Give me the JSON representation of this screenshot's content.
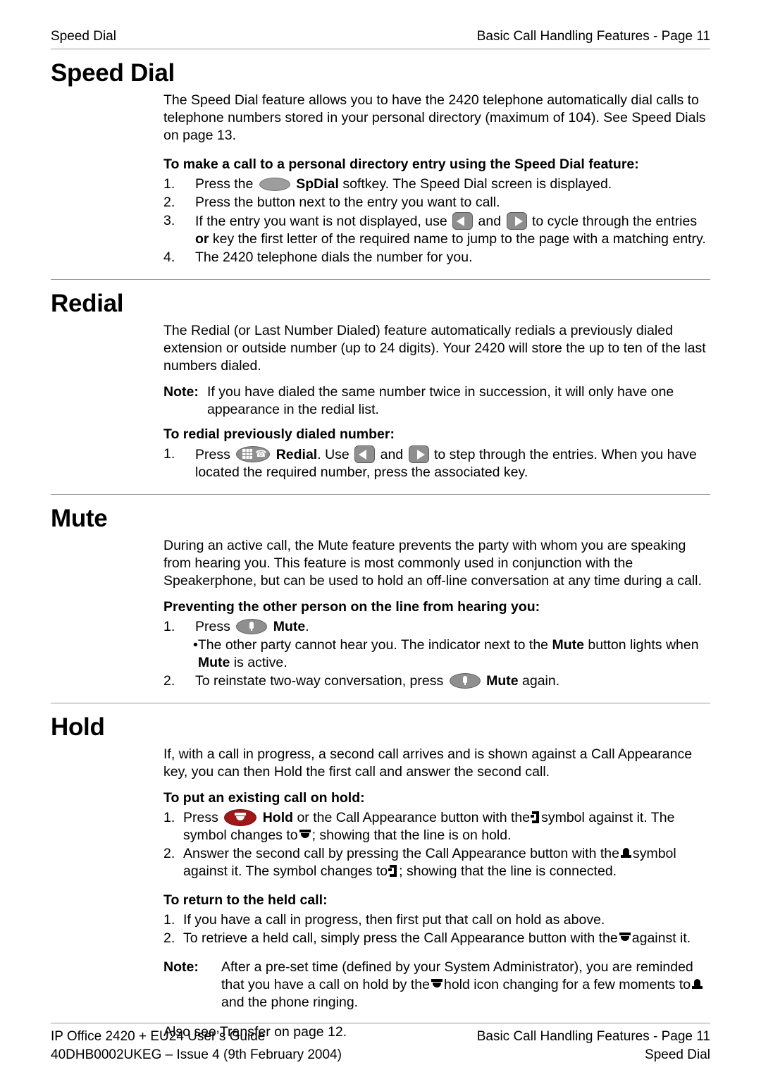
{
  "header": {
    "left": "Speed Dial",
    "right": "Basic Call Handling Features - Page 11"
  },
  "sections": {
    "speed_dial": {
      "title": "Speed Dial",
      "lead": "The Speed Dial feature allows you to have the 2420 telephone automatically dial calls to telephone numbers stored in your personal directory (maximum of 104). See Speed Dials on page 13.",
      "subhead": "To make a call to a personal directory entry using the Speed Dial feature:",
      "step1_num": "1.",
      "step1_a": "Press the",
      "step1_bold": "SpDial",
      "step1_b": "softkey. The Speed Dial screen is displayed.",
      "step2_num": "2.",
      "step2": "Press the button next to the entry you want to call.",
      "step3_num": "3.",
      "step3_a": "If the entry you want is not displayed, use",
      "step3_and": "and",
      "step3_b": "to cycle through the entries",
      "step3_or": "or",
      "step3_c": "key the first letter of the required name to jump to the page with a matching entry.",
      "step4_num": "4.",
      "step4": "The 2420 telephone dials the number for you."
    },
    "redial": {
      "title": "Redial",
      "lead": "The Redial (or Last Number Dialed) feature automatically redials a previously dialed extension or outside number (up to 24 digits). Your 2420 will store the up to ten of the last numbers dialed.",
      "note_label": "Note:",
      "note_text": "If you have dialed the same number twice in succession, it will only have one appearance in the redial list.",
      "subhead": "To redial previously dialed number:",
      "step1_num": "1.",
      "step1_a": "Press",
      "step1_bold": "Redial",
      "step1_b": ". Use",
      "step1_and": "and",
      "step1_c": "to step through the entries. When you have located the required number, press the associated key."
    },
    "mute": {
      "title": "Mute",
      "lead": "During an active call, the Mute feature prevents the party with whom you are speaking from hearing you. This feature is most commonly used in conjunction with the Speakerphone, but can be used to hold an off-line conversation at any time during a call.",
      "subhead": "Preventing the other person on the line from hearing you:",
      "step1_num": "1.",
      "step1_a": "Press",
      "step1_bold": "Mute",
      "step1_b": ".",
      "bullet_mark": "•",
      "bullet_a": "The other party cannot hear you. The indicator next to the",
      "bullet_bold1": "Mute",
      "bullet_b": "button lights when",
      "bullet_bold2": "Mute",
      "bullet_c": "is active.",
      "step2_num": "2.",
      "step2_a": "To reinstate two-way conversation, press",
      "step2_bold": "Mute",
      "step2_b": "again."
    },
    "hold": {
      "title": "Hold",
      "lead": "If, with a call in progress, a second call arrives and is shown against a Call Appearance key, you can then Hold the first call and answer the second call.",
      "subhead1": "To put an existing call on hold:",
      "step1_num": "1.",
      "step1_a": "Press",
      "step1_bold": "Hold",
      "step1_b": "or the Call Appearance button with the",
      "step1_c": "symbol against it. The symbol changes to",
      "step1_d": "; showing that the line is on hold.",
      "step2_num": "2.",
      "step2_a": "Answer the second call by pressing the Call Appearance button with the",
      "step2_b": "symbol against it. The symbol changes to",
      "step2_c": "; showing that the line is connected.",
      "subhead2": "To return to the held call:",
      "r1_num": "1.",
      "r1": "If you have a call in progress, then first put that call on hold as above.",
      "r2_num": "2.",
      "r2_a": "To retrieve a held call, simply press the Call Appearance button with the",
      "r2_b": "against it.",
      "note_label": "Note:",
      "note_a": "After a pre-set time (defined by your System Administrator), you are reminded that you have a call on hold by the",
      "note_b": "hold icon changing for a few moments to",
      "note_c": "and the phone ringing.",
      "also_see": "Also see Transfer on page 12."
    }
  },
  "footer": {
    "left_line1": "IP Office 2420 + EU24 User’s Guide",
    "left_line2": "40DHB0002UKEG – Issue 4 (9th February 2004)",
    "right_line1": "Basic Call Handling Features - Page 11",
    "right_line2": "Speed Dial"
  },
  "icons": {
    "spdial_button": "spdial-softkey-icon",
    "redial_button": "redial-button-icon",
    "mute_button": "mute-button-icon",
    "hold_button": "hold-button-icon",
    "left_arrow": "left-arrow-button-icon",
    "right_arrow": "right-arrow-button-icon",
    "ringing_symbol": "ringing-call-symbol",
    "connected_symbol": "connected-call-symbol",
    "hold_symbol": "call-on-hold-symbol"
  },
  "colors": {
    "hold_button": "#a01818",
    "button_gray": "#8f8f8f",
    "rule_gray": "#9a9a9a",
    "text": "#000000"
  }
}
